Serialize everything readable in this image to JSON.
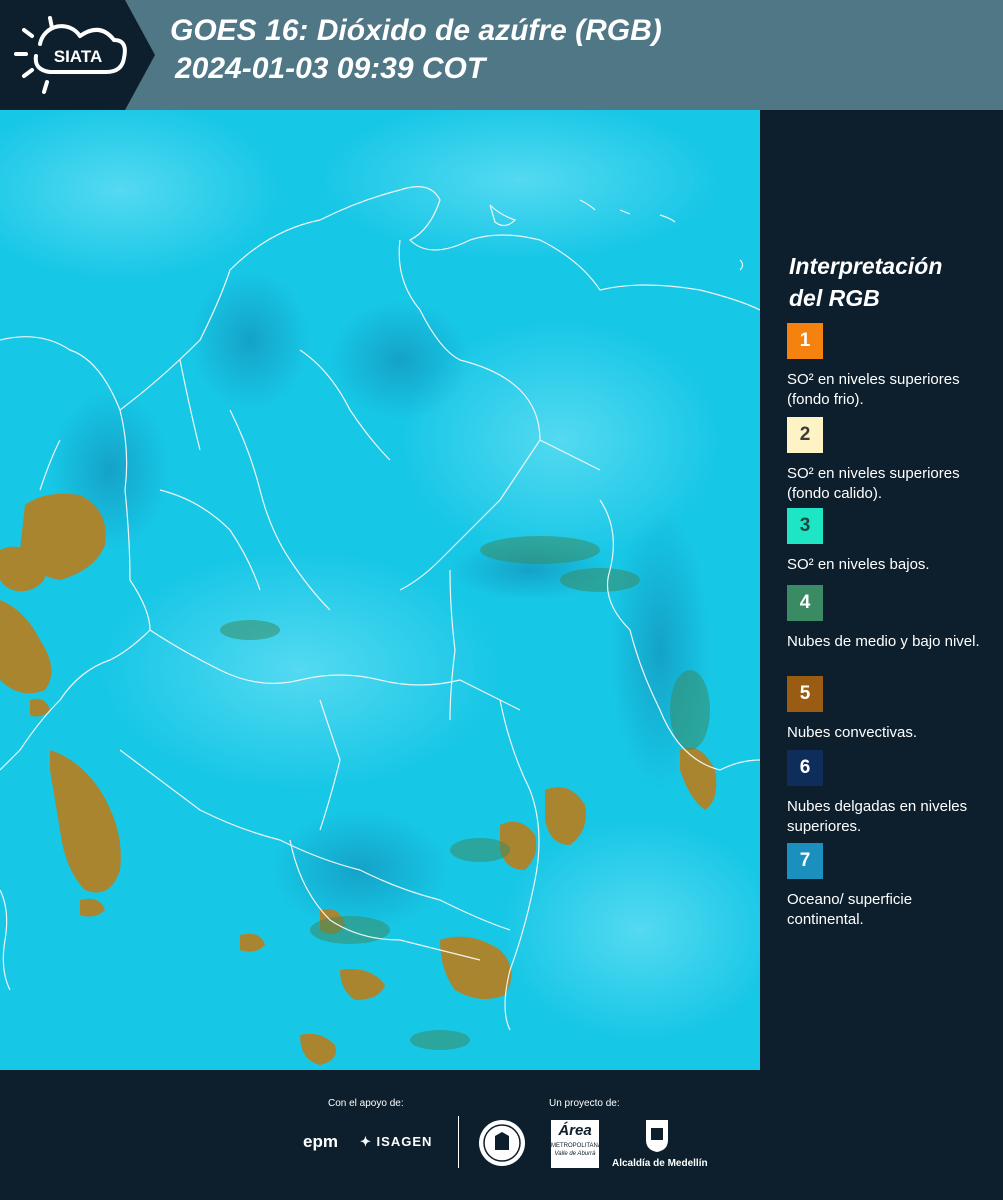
{
  "header": {
    "logo_text": "SIATA",
    "title_line1": "GOES 16: Dióxido de azúfre (RGB)",
    "title_line2": "2024-01-03 09:39 COT"
  },
  "legend": {
    "title_line1": "Interpretación",
    "title_line2": "del RGB",
    "items": [
      {
        "number": "1",
        "color": "#f5820f",
        "text_color": "#ffffff",
        "label": "SO² en niveles superiores (fondo frio)."
      },
      {
        "number": "2",
        "color": "#fdf3c4",
        "text_color": "#3b3b3b",
        "label": "SO² en niveles superiores (fondo calido)."
      },
      {
        "number": "3",
        "color": "#1ee6c4",
        "text_color": "#1b4a44",
        "label": "SO² en niveles bajos."
      },
      {
        "number": "4",
        "color": "#3a8a63",
        "text_color": "#ffffff",
        "label": "Nubes de medio y bajo nivel."
      },
      {
        "number": "5",
        "color": "#9a5c12",
        "text_color": "#ffffff",
        "label": "Nubes convectivas."
      },
      {
        "number": "6",
        "color": "#0f2d5b",
        "text_color": "#ffffff",
        "label": "Nubes delgadas en niveles superiores."
      },
      {
        "number": "7",
        "color": "#1b8fbd",
        "text_color": "#ffffff",
        "label": "Oceano/ superficie continental."
      }
    ]
  },
  "footer": {
    "support_caption": "Con el apoyo de:",
    "project_caption": "Un proyecto de:",
    "epm_logo": "epm",
    "isagen_logo": "ISAGEN",
    "area_logo_main": "Área",
    "area_logo_sub": "METROPOLITANA",
    "area_logo_sub2": "Valle de Aburrá",
    "alcaldia_logo": "Alcaldía de Medellín"
  },
  "map": {
    "background_color": "#17c7e6",
    "convective_color": "#a9852f",
    "border_color": "#f0f4f4"
  }
}
